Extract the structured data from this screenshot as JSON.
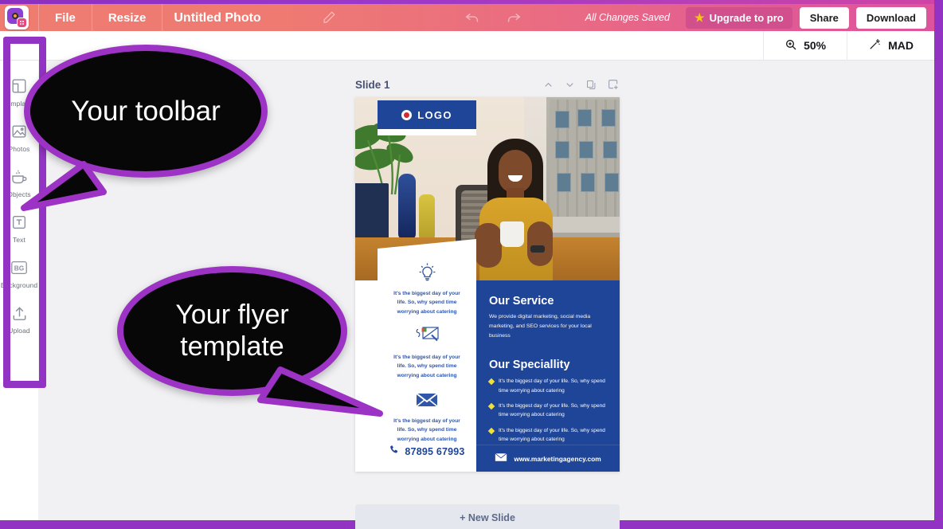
{
  "app": {
    "logo_icon": "camera-app-logo-icon",
    "menu": [
      {
        "label": "File",
        "name": "file-menu"
      },
      {
        "label": "Resize",
        "name": "resize-menu"
      }
    ],
    "document_title": "Untitled Photo",
    "edit_title_icon": "pencil-icon",
    "undo_icon": "undo-arrow-icon",
    "redo_icon": "redo-arrow-icon",
    "save_status": "All Changes Saved",
    "upgrade_label": "Upgrade to pro",
    "upgrade_icon": "star-icon",
    "share_label": "Share",
    "download_label": "Download",
    "colors": {
      "topbar_left": "#ef7c71",
      "topbar_right": "#de549c",
      "accent_purple": "#9333c4",
      "brand_blue": "#1e4598",
      "upgrade_pink": "#d24f8e",
      "bullet_yellow": "#f2e03a"
    }
  },
  "subbar": {
    "zoom_icon": "zoom-magnifier-icon",
    "zoom_level": "50%",
    "mad_icon": "magic-wand-icon",
    "mad_label": "MAD"
  },
  "sidebar": {
    "items": [
      {
        "label": "Templates",
        "icon": "templates-icon"
      },
      {
        "label": "Photos",
        "icon": "photos-icon"
      },
      {
        "label": "Objects",
        "icon": "objects-cup-icon"
      },
      {
        "label": "Text",
        "icon": "text-t-icon"
      },
      {
        "label": "Background",
        "icon": "background-bg-icon"
      },
      {
        "label": "Upload",
        "icon": "upload-arrow-icon"
      }
    ]
  },
  "callouts": [
    {
      "text": "Your toolbar",
      "name": "callout-toolbar"
    },
    {
      "text": "Your flyer template",
      "name": "callout-flyer-template"
    }
  ],
  "slide": {
    "title": "Slide 1",
    "move_up_icon": "chevron-up-icon",
    "move_down_icon": "chevron-down-icon",
    "duplicate_icon": "duplicate-slide-icon",
    "add_icon": "add-slide-icon",
    "new_slide_label": "+ New Slide"
  },
  "flyer": {
    "logo_text": "LOGO",
    "logo_dot_icon": "logo-circle-icon",
    "features": [
      {
        "icon": "lightbulb-icon",
        "text": "It's the biggest day of your life. So, why spend time worrying about catering"
      },
      {
        "icon": "drawing-tablet-pen-icon",
        "text": "It's the biggest day of your life. So, why spend time worrying about catering"
      },
      {
        "icon": "envelope-icon",
        "text": "It's the biggest day of your life. So, why spend time worrying about catering"
      }
    ],
    "phone_icon": "phone-icon",
    "phone": "87895 67993",
    "service_heading": "Our Service",
    "service_text": "We provide digital marketing, social media marketing, and SEO services for your local business",
    "speciality_heading": "Our Speciallity",
    "speciality_items": [
      "It's the biggest day of your life. So, why spend time worrying about catering",
      "It's the biggest day of your life. So, why spend time worrying about catering",
      "It's the biggest day of your life. So, why spend time worrying about catering"
    ],
    "website_icon": "envelope-white-icon",
    "website": "www.marketingagency.com"
  }
}
